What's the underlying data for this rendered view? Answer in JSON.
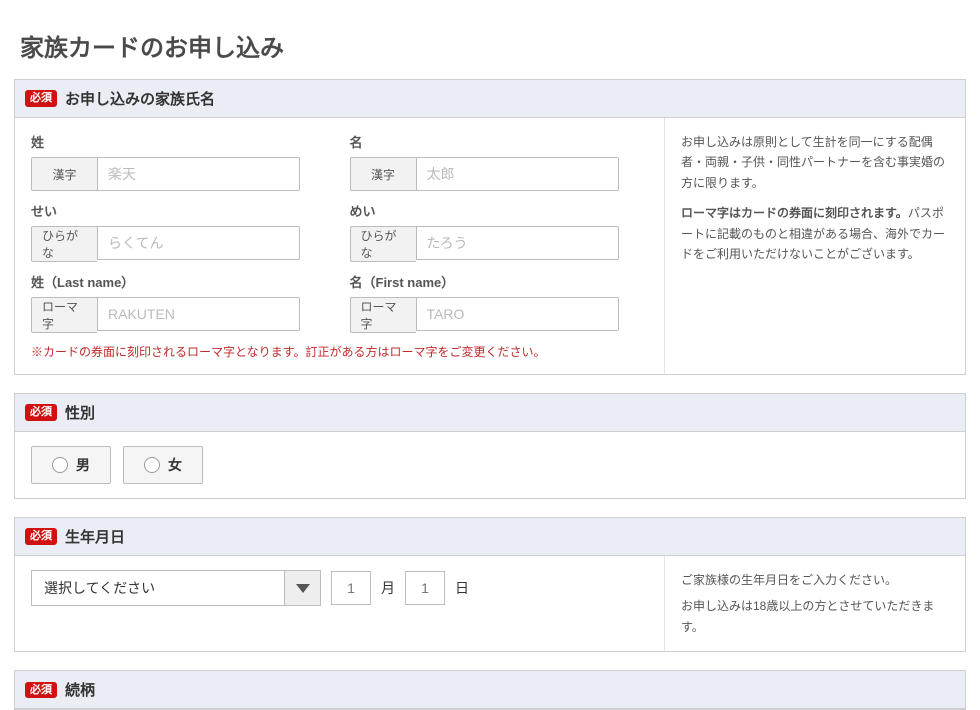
{
  "page_title": "家族カードのお申し込み",
  "required_badge": "必須",
  "sections": {
    "name": {
      "title": "お申し込みの家族氏名",
      "fields": {
        "sei_kanji": {
          "label": "姓",
          "prefix": "漢字",
          "placeholder": "楽天"
        },
        "mei_kanji": {
          "label": "名",
          "prefix": "漢字",
          "placeholder": "太郎"
        },
        "sei_hira": {
          "label": "せい",
          "prefix": "ひらがな",
          "placeholder": "らくてん"
        },
        "mei_hira": {
          "label": "めい",
          "prefix": "ひらがな",
          "placeholder": "たろう"
        },
        "sei_roman": {
          "label": "姓（Last name）",
          "prefix": "ローマ字",
          "placeholder": "RAKUTEN"
        },
        "mei_roman": {
          "label": "名（First name）",
          "prefix": "ローマ字",
          "placeholder": "TARO"
        }
      },
      "warning": "※カードの券面に刻印されるローマ字となります。訂正がある方はローマ字をご変更ください。",
      "side_note_1": "お申し込みは原則として生計を同一にする配偶者・両親・子供・同性パートナーを含む事実婚の方に限ります。",
      "side_note_2a": "ローマ字はカードの券面に刻印されます。",
      "side_note_2b": "パスポートに記載のものと相違がある場合、海外でカードをご利用いただけないことがございます。"
    },
    "gender": {
      "title": "性別",
      "option_male": "男",
      "option_female": "女"
    },
    "birth": {
      "title": "生年月日",
      "year_placeholder": "選択してください",
      "month_default": "1",
      "month_unit": "月",
      "day_default": "1",
      "day_unit": "日",
      "side_note_1": "ご家族様の生年月日をご入力ください。",
      "side_note_2": "お申し込みは18歳以上の方とさせていただきます。"
    },
    "relation": {
      "title": "続柄"
    }
  }
}
